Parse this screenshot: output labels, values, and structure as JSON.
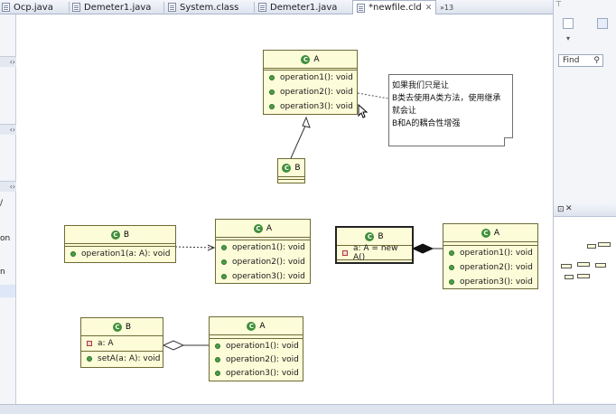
{
  "tabs": [
    {
      "label": "Ocp.java"
    },
    {
      "label": "Demeter1.java"
    },
    {
      "label": "System.class"
    },
    {
      "label": "Demeter1.java"
    },
    {
      "label": "*newfile.cld",
      "active": true
    }
  ],
  "tab_overflow": "»13",
  "right_panel": {
    "find_label": "Find"
  },
  "diagram": {
    "top_a": {
      "name": "A",
      "methods": [
        "operation1(): void",
        "operation2(): void",
        "operation3(): void"
      ]
    },
    "top_b": {
      "name": "B"
    },
    "note": {
      "lines": [
        "如果我们只是让",
        "B类去使用A类方法，使用继承",
        "就会让",
        "B和A的耦合性增强"
      ]
    },
    "dep_b": {
      "name": "B",
      "methods": [
        "operation1(a: A): void"
      ]
    },
    "dep_a": {
      "name": "A",
      "methods": [
        "operation1(): void",
        "operation2(): void",
        "operation3(): void"
      ]
    },
    "comp_b": {
      "name": "B",
      "fields": [
        "a: A = new A()"
      ]
    },
    "comp_a": {
      "name": "A",
      "methods": [
        "operation1(): void",
        "operation2(): void",
        "operation3(): void"
      ]
    },
    "agg_b": {
      "name": "B",
      "fields": [
        "a: A"
      ],
      "methods": [
        "setA(a: A): void"
      ]
    },
    "agg_a": {
      "name": "A",
      "methods": [
        "operation1(): void",
        "operation2(): void",
        "operation3(): void"
      ]
    }
  },
  "left_panel_fragments": [
    "/",
    "on",
    "n"
  ]
}
